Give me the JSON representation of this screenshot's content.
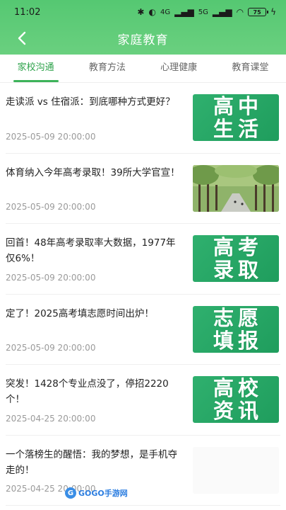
{
  "status": {
    "time": "11:02",
    "network": "4G",
    "network2": "5G",
    "battery": "75"
  },
  "header": {
    "title": "家庭教育"
  },
  "tabs": [
    {
      "label": "家校沟通",
      "active": true
    },
    {
      "label": "教育方法",
      "active": false
    },
    {
      "label": "心理健康",
      "active": false
    },
    {
      "label": "教育课堂",
      "active": false
    }
  ],
  "articles": [
    {
      "title": "走读派 vs 住宿派：到底哪种方式更好？",
      "date": "2025-05-09 20:00:00",
      "thumb_lines": [
        "高中",
        "生活"
      ]
    },
    {
      "title": "体育纳入今年高考录取！39所大学官宣！",
      "date": "2025-05-09 20:00:00",
      "thumb_lines": []
    },
    {
      "title": "回首！48年高考录取率大数据，1977年仅6%！",
      "date": "2025-05-09 20:00:00",
      "thumb_lines": [
        "高考",
        "录取"
      ]
    },
    {
      "title": "定了！2025高考填志愿时间出炉！",
      "date": "2025-05-09 20:00:00",
      "thumb_lines": [
        "志愿",
        "填报"
      ]
    },
    {
      "title": "突发！1428个专业点没了，停招2220个！",
      "date": "2025-04-25 20:00:00",
      "thumb_lines": [
        "高校",
        "资讯"
      ]
    },
    {
      "title": "一个落榜生的醒悟：我的梦想，是手机夺走的！",
      "date": "2025-04-25 20:00:00",
      "thumb_lines": []
    }
  ],
  "watermark": {
    "text": "GOGO手游网"
  },
  "colors": {
    "header_green": "#5ccb77",
    "accent": "#2fa34c",
    "thumb_green": "#2aa865"
  }
}
